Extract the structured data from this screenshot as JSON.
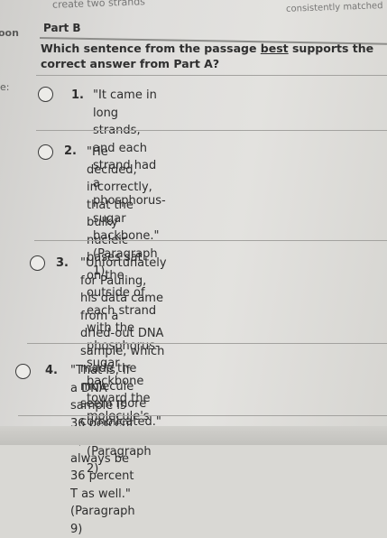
{
  "background_fragments": {
    "top": "create two strands",
    "top_right": "consistently matched",
    "left_1": "oon",
    "left_2": "e:"
  },
  "part": {
    "label": "Part B"
  },
  "question": {
    "before": "Which sentence from the passage ",
    "underlined": "best",
    "after": " supports the correct answer from Part A?"
  },
  "options": [
    {
      "number": "1.",
      "lines": [
        "\"It came in long strands, and each strand had a",
        "phosphorus-sugar backbone.\" (Paragraph 1)"
      ]
    },
    {
      "number": "2.",
      "lines": [
        "\"He decided, incorrectly, that the bulky nucleic",
        "bases sat on the outside of each strand with the",
        "phosphorus-sugar backbone toward the",
        "molecule's core.\" (Paragraph 2)"
      ]
    },
    {
      "number": "3.",
      "lines": [
        "\"Unfortunately for Pauling, his data came from a",
        "dried-out DNA sample, which made the",
        "molecule seem more complicated.\"",
        "(Paragraph 2)"
      ]
    },
    {
      "number": "4.",
      "lines": [
        "\"That is, if a DNA sample is 36 percent A, it will",
        "always be 36 percent T as well.\" (Paragraph 9)"
      ]
    }
  ]
}
